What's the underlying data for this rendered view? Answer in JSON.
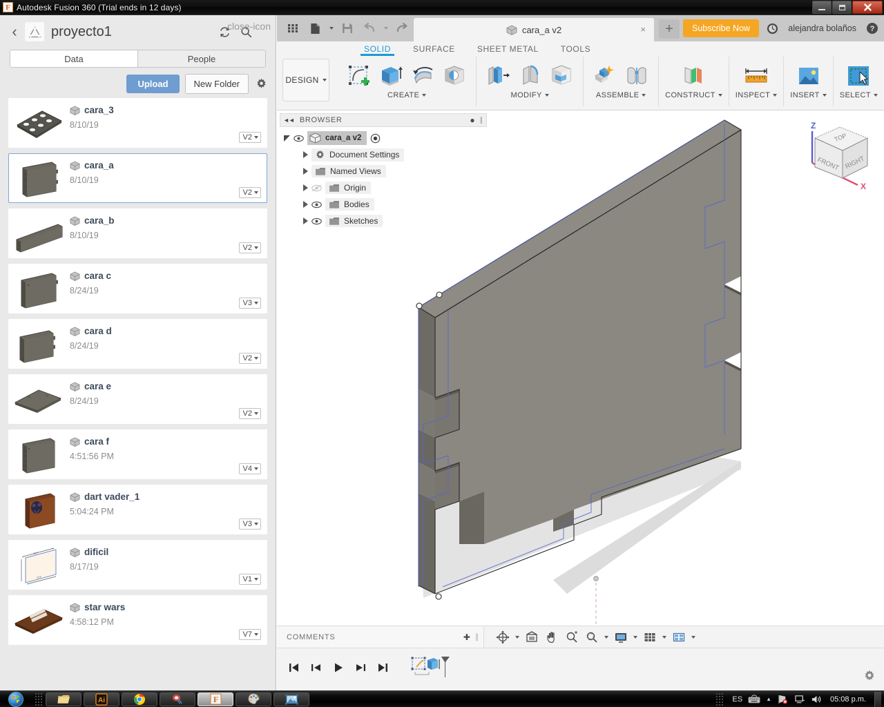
{
  "window": {
    "title": "Autodesk Fusion 360 (Trial ends in 12 days)",
    "app_icon": "F",
    "minimize_label": "Minimize",
    "maximize_label": "Restore",
    "close_label": "Close"
  },
  "data_panel": {
    "back_label": "‹",
    "project_name": "proyecto1",
    "refresh_icon": "refresh-icon",
    "search_icon": "search-icon",
    "close_icon": "close-icon",
    "tabs": [
      {
        "label": "Data",
        "active": true
      },
      {
        "label": "People",
        "active": false
      }
    ],
    "upload_label": "Upload",
    "new_folder_label": "New Folder",
    "settings_icon": "gear-icon",
    "items": [
      {
        "name": "cara_3",
        "date": "8/10/19",
        "version": "V2",
        "selected": false,
        "thumb": "perforated-plate"
      },
      {
        "name": "cara_a",
        "date": "8/10/19",
        "version": "V2",
        "selected": true,
        "thumb": "notched-panel"
      },
      {
        "name": "cara_b",
        "date": "8/10/19",
        "version": "V2",
        "selected": false,
        "thumb": "long-strip"
      },
      {
        "name": "cara c",
        "date": "8/24/19",
        "version": "V3",
        "selected": false,
        "thumb": "flat-panel"
      },
      {
        "name": "cara d",
        "date": "8/24/19",
        "version": "V2",
        "selected": false,
        "thumb": "flat-panel"
      },
      {
        "name": "cara e",
        "date": "8/24/19",
        "version": "V2",
        "selected": false,
        "thumb": "flat-lying-panel"
      },
      {
        "name": "cara f",
        "date": "4:51:56 PM",
        "version": "V4",
        "selected": false,
        "thumb": "slotted-panel"
      },
      {
        "name": "dart vader_1",
        "date": "5:04:24 PM",
        "version": "V3",
        "selected": false,
        "thumb": "engraved-wood"
      },
      {
        "name": "dificil",
        "date": "8/17/19",
        "version": "V1",
        "selected": false,
        "thumb": "sketch-dimensions"
      },
      {
        "name": "star wars",
        "date": "4:58:12 PM",
        "version": "V7",
        "selected": false,
        "thumb": "star-wars-plate"
      }
    ]
  },
  "quick_access": {
    "grid_icon": "app-grid-icon",
    "file_icon": "new-file-icon",
    "save_icon": "save-icon",
    "undo_icon": "undo-icon",
    "redo_icon": "redo-icon",
    "document_tab": "cara_a v2",
    "document_tab_close": "×",
    "new_tab_label": "+",
    "subscribe_label": "Subscribe Now",
    "clock_icon": "trial-clock-icon",
    "user_name": "alejandra bolaños",
    "help_icon": "help-icon"
  },
  "ribbon": {
    "workspace": "DESIGN",
    "tabs": [
      {
        "label": "SOLID",
        "active": true
      },
      {
        "label": "SURFACE",
        "active": false
      },
      {
        "label": "SHEET METAL",
        "active": false
      },
      {
        "label": "TOOLS",
        "active": false
      }
    ],
    "groups": [
      {
        "label": "CREATE",
        "icons": [
          "sketch-create-icon",
          "extrude-icon",
          "revolve-icon",
          "hole-icon"
        ]
      },
      {
        "label": "MODIFY",
        "icons": [
          "press-pull-icon",
          "fillet-icon",
          "shell-icon"
        ]
      },
      {
        "label": "ASSEMBLE",
        "icons": [
          "new-component-icon",
          "joint-icon"
        ]
      },
      {
        "label": "CONSTRUCT",
        "icons": [
          "offset-plane-icon"
        ]
      },
      {
        "label": "INSPECT",
        "icons": [
          "measure-icon"
        ]
      },
      {
        "label": "INSERT",
        "icons": [
          "insert-image-icon"
        ]
      },
      {
        "label": "SELECT",
        "icons": [
          "select-window-icon"
        ]
      }
    ]
  },
  "browser": {
    "title": "BROWSER",
    "collapse_icon": "collapse-left-icon",
    "minimize_icon": "minimize-panel-icon",
    "root": {
      "label": "cara_a v2",
      "visibility_icon": "eye-icon",
      "component_icon": "component-icon",
      "activate_icon": "activate-radio-icon"
    },
    "nodes": [
      {
        "label": "Document Settings",
        "icon": "gear-icon",
        "visible": null
      },
      {
        "label": "Named Views",
        "icon": "folder-icon",
        "visible": null
      },
      {
        "label": "Origin",
        "icon": "folder-icon",
        "visible": false
      },
      {
        "label": "Bodies",
        "icon": "folder-icon",
        "visible": true
      },
      {
        "label": "Sketches",
        "icon": "folder-icon",
        "visible": true
      }
    ]
  },
  "viewcube": {
    "top_label": "TOP",
    "front_label": "FRONT",
    "right_label": "RIGHT",
    "axis_z": "Z",
    "axis_x": "X"
  },
  "comments": {
    "label": "COMMENTS",
    "add_icon": "add-comment-icon"
  },
  "nav_bar": {
    "tools": [
      {
        "icon": "orbit-icon",
        "has_dropdown": true
      },
      {
        "icon": "look-at-icon",
        "has_dropdown": false
      },
      {
        "icon": "pan-icon",
        "has_dropdown": false
      },
      {
        "icon": "zoom-icon",
        "has_dropdown": false
      },
      {
        "icon": "zoom-window-icon",
        "has_dropdown": true
      },
      {
        "icon": "display-settings-icon",
        "has_dropdown": true
      },
      {
        "icon": "grid-snaps-icon",
        "has_dropdown": true
      },
      {
        "icon": "viewports-icon",
        "has_dropdown": true
      }
    ]
  },
  "timeline": {
    "controls": [
      "skip-to-beginning-icon",
      "step-back-icon",
      "play-icon",
      "step-forward-icon",
      "skip-to-end-icon"
    ],
    "features": [
      "sketch-feature-icon",
      "extrude-feature-icon"
    ],
    "marker_icon": "timeline-marker-icon",
    "settings_icon": "timeline-settings-icon"
  },
  "taskbar": {
    "start_label": "Start",
    "items": [
      {
        "icon": "windows-explorer-icon",
        "active": false
      },
      {
        "icon": "illustrator-icon",
        "active": false
      },
      {
        "icon": "chrome-icon",
        "active": false
      },
      {
        "icon": "paint-tool-icon",
        "active": false
      },
      {
        "icon": "fusion360-icon",
        "active": true
      },
      {
        "icon": "palette-icon",
        "active": false
      },
      {
        "icon": "photo-viewer-icon",
        "active": false
      }
    ],
    "language": "ES",
    "keyboard_icon": "keyboard-icon",
    "show_hidden_icon": "show-hidden-icons",
    "network_icon": "network-error-icon",
    "action_center_icon": "action-center-icon",
    "volume_icon": "volume-icon",
    "clock": "05:08 p.m."
  },
  "colors": {
    "accent_blue": "#1c9ad6",
    "upload_blue": "#6f9cd1",
    "subscribe_orange": "#f5a623",
    "selection_blue": "#7ba7d7",
    "model_gray": "#8b8983",
    "sketch_blue": "#5566cc"
  }
}
